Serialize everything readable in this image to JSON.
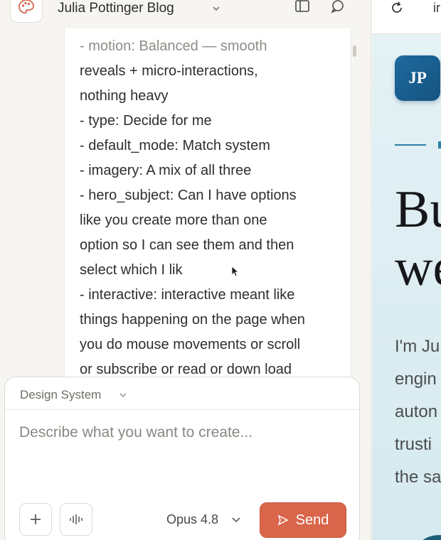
{
  "header": {
    "project_title": "Julia Pottinger Blog",
    "app_icon": "palette-icon",
    "title_chevron_icon": "chevron-down-icon",
    "sidebar_toggle_icon": "sidebar-panel-icon",
    "chat_icon": "chat-bubble-icon"
  },
  "message": {
    "lines": [
      "- motion: Balanced — smooth",
      "reveals + micro-interactions,",
      "nothing heavy",
      "- type: Decide for me",
      "- default_mode: Match system",
      "- imagery: A mix of all three",
      "- hero_subject: Can I have options",
      "like you create more than one",
      "option so I can see them and then",
      "select which I lik",
      "- interactive: interactive meant like",
      "things happening on the page when",
      "you do mouse movements or scroll",
      "or subscribe or read or down load"
    ]
  },
  "composer": {
    "design_system_label": "Design System",
    "prompt_placeholder": "Describe what you want to create...",
    "prompt_value": "",
    "add_icon": "plus-icon",
    "voice_icon": "waveform-icon",
    "model_label": "Opus 4.8",
    "send_label": "Send",
    "send_icon": "send-arrow-icon"
  },
  "preview": {
    "reload_icon": "reload-icon",
    "url_fragment": "ir",
    "badge_initials": "JP",
    "hero_lines": [
      "Bu",
      "we"
    ],
    "intro_lines": [
      "I'm Ju",
      "engin",
      "auton",
      "trusti",
      "the sa"
    ]
  },
  "colors": {
    "accent_send": "#d9654a",
    "badge_blue": "#1f6aa0",
    "preview_bg": "#e4f1f5"
  }
}
